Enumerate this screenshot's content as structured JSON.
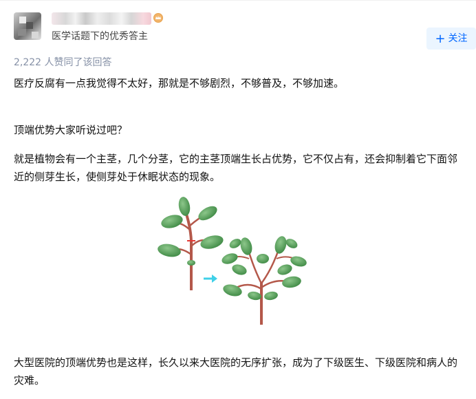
{
  "author": {
    "headline": "医学话题下的优秀答主"
  },
  "follow_button": {
    "icon": "plus-icon",
    "label": "关注"
  },
  "answer": {
    "votes_text": "2,222 人赞同了该回答",
    "paragraphs": [
      "医疗反腐有一点我觉得不太好，那就是不够剧烈，不够普及，不够加速。",
      "顶端优势大家听说过吧？",
      "就是植物会有一个主茎，几个分茎，它的主茎顶端生长占优势，它不仅占有，还会抑制着它下面邻近的侧芽生长，使侧芽处于休眠状态的现象。",
      "大型医院的顶端优势也是这样，长久以来大医院的无序扩张，成为了下级医生、下级医院和病人的灾难。"
    ]
  },
  "colors": {
    "accent": "#0066ff",
    "follow_bg": "#ebf5ff",
    "meta_text": "#8590a6",
    "leaf": "#5fa35f",
    "stem": "#b4584a",
    "arrow": "#3fd0e8",
    "cut_mark": "#e53935"
  }
}
